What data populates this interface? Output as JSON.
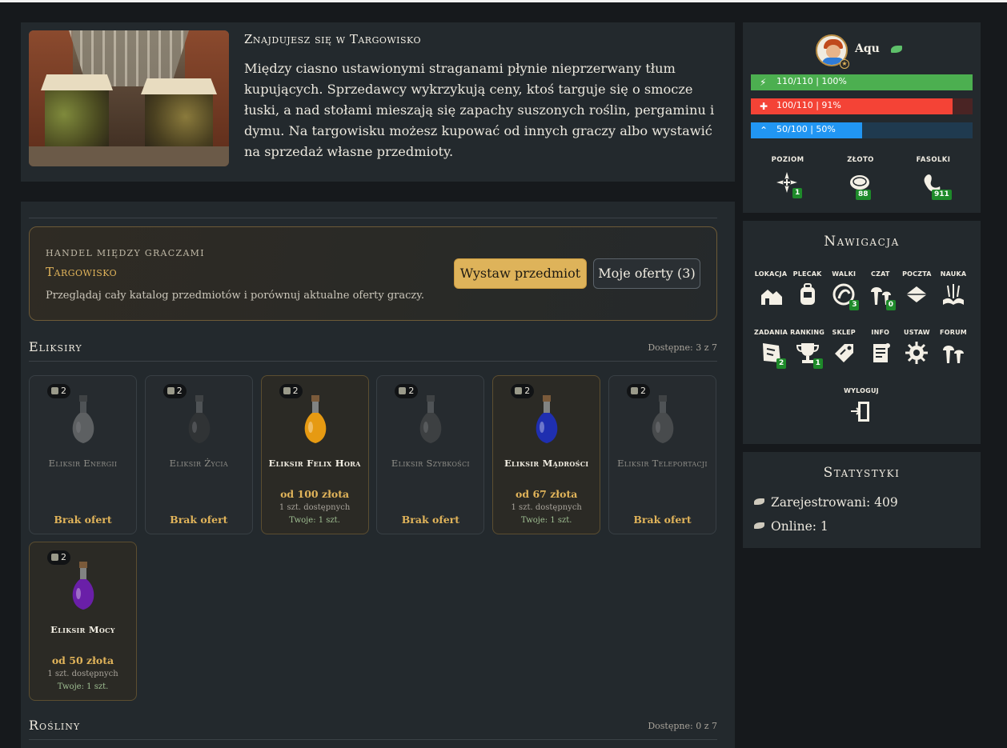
{
  "location": {
    "title": "Znajdujesz się w Targowisko",
    "description": "Między ciasno ustawionymi straganami płynie nieprzerwany tłum kupujących. Sprzedawcy wykrzykują ceny, ktoś targuje się o smocze łuski, a nad stołami mieszają się zapachy suszonych roślin, pergaminu i dymu. Na targowisku możesz kupować od innych graczy albo wystawić na sprzedaż własne przedmioty.",
    "image": "market-hall-image"
  },
  "market": {
    "kicker": "HANDEL MIĘDZY GRACZAMI",
    "title": "Targowisko",
    "description": "Przeglądaj cały katalog przedmiotów i porównuj aktualne oferty graczy.",
    "sell_button": "Wystaw przedmiot",
    "my_offers_button": "Moje oferty (3)"
  },
  "sections": [
    {
      "title": "Eliksiry",
      "count": "Dostępne: 3 z 7",
      "items": [
        {
          "name": "Eliksir Energii",
          "qty": "2",
          "owned": false,
          "no_offers": "Brak ofert",
          "bottle_color": "#9aa2a8"
        },
        {
          "name": "Eliksir Życia",
          "qty": "2",
          "owned": false,
          "no_offers": "Brak ofert",
          "bottle_color": "#3a3f44"
        },
        {
          "name": "Eliksir Felix Hora",
          "qty": "2",
          "owned": true,
          "price": "od 100 złota",
          "available": "1 szt. dostępnych",
          "yours": "Twoje: 1 szt.",
          "bottle_color": "#e69a12"
        },
        {
          "name": "Eliksir Szybkości",
          "qty": "2",
          "owned": false,
          "no_offers": "Brak ofert",
          "bottle_color": "#555b60"
        },
        {
          "name": "Eliksir Mądrości",
          "qty": "2",
          "owned": true,
          "price": "od 67 złota",
          "available": "1 szt. dostępnych",
          "yours": "Twoje: 1 szt.",
          "bottle_color": "#1f2fb0"
        },
        {
          "name": "Eliksir Teleportacji",
          "qty": "2",
          "owned": false,
          "no_offers": "Brak ofert",
          "bottle_color": "#6f7478"
        },
        {
          "name": "Eliksir Mocy",
          "qty": "2",
          "owned": true,
          "price": "od 50 złota",
          "available": "1 szt. dostępnych",
          "yours": "Twoje: 1 szt.",
          "bottle_color": "#6a1fa8"
        }
      ]
    },
    {
      "title": "Rośliny",
      "count": "Dostępne: 0 z 7",
      "items": []
    }
  ],
  "player": {
    "name": "Aqu",
    "energy": {
      "label": "110/110 | 100%",
      "fraction": 1.0,
      "color": "#4caf50"
    },
    "health": {
      "label": "100/110 | 91%",
      "fraction": 0.91,
      "color": "#f44336"
    },
    "exp": {
      "label": "50/100 | 50%",
      "fraction": 0.5,
      "color": "#2196f3"
    },
    "stats": [
      {
        "label": "POZIOM",
        "value": "1",
        "icon": "level-icon"
      },
      {
        "label": "ZŁOTO",
        "value": "88",
        "icon": "coin-icon"
      },
      {
        "label": "FASOLKI",
        "value": "911",
        "icon": "bean-icon"
      }
    ]
  },
  "navigation": {
    "title": "Nawigacja",
    "items": [
      {
        "label": "LOKACJA",
        "icon": "location-icon",
        "badge": ""
      },
      {
        "label": "PLECAK",
        "icon": "backpack-icon",
        "badge": ""
      },
      {
        "label": "WALKI",
        "icon": "fight-icon",
        "badge": "3"
      },
      {
        "label": "CZAT",
        "icon": "chat-icon",
        "badge": "0"
      },
      {
        "label": "POCZTA",
        "icon": "mail-icon",
        "badge": ""
      },
      {
        "label": "NAUKA",
        "icon": "book-icon",
        "badge": ""
      },
      {
        "label": "ZADANIA",
        "icon": "quest-map-icon",
        "badge": "2"
      },
      {
        "label": "RANKING",
        "icon": "trophy-icon",
        "badge": "1"
      },
      {
        "label": "SKLEP",
        "icon": "shop-tag-icon",
        "badge": ""
      },
      {
        "label": "INFO",
        "icon": "info-scroll-icon",
        "badge": ""
      },
      {
        "label": "USTAW",
        "icon": "settings-gear-icon",
        "badge": ""
      },
      {
        "label": "FORUM",
        "icon": "forum-icon",
        "badge": ""
      },
      {
        "label": "WYLOGUJ",
        "icon": "logout-door-icon",
        "badge": ""
      }
    ]
  },
  "statistics": {
    "title": "Statystyki",
    "registered": "Zarejestrowani: 409",
    "online": "Online: 1"
  }
}
